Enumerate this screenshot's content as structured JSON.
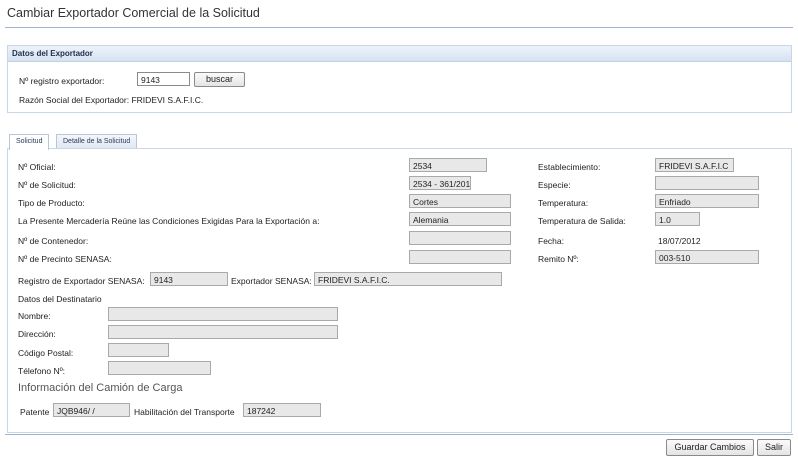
{
  "page": {
    "title": "Cambiar Exportador Comercial de la Solicitud"
  },
  "exporter_panel": {
    "header": "Datos del Exportador",
    "registro_label": "Nº registro exportador:",
    "registro_value": "9143",
    "search_button": "buscar",
    "razon_social": "Razón Social del Exportador: FRIDEVI S.A.F.I.C."
  },
  "tabs": [
    {
      "label": "Solicitud",
      "active": true
    },
    {
      "label": "Detalle de la Solicitud",
      "active": false
    }
  ],
  "solicitud": {
    "left": [
      {
        "label": "Nº Oficial:",
        "value": "2534"
      },
      {
        "label": "Nº de Solicitud:",
        "value": "2534 - 361/201"
      },
      {
        "label": "Tipo de Producto:",
        "value": "Cortes"
      },
      {
        "label": "La Presente Mercadería Reúne las Condiciones Exigidas Para la Exportación a:",
        "value": "Alemania"
      },
      {
        "label": "Nº de Contenedor:",
        "value": ""
      },
      {
        "label": "Nº de Precinto SENASA:",
        "value": ""
      }
    ],
    "right": [
      {
        "label": "Establecimiento:",
        "value": "FRIDEVI S.A.F.I.C"
      },
      {
        "label": "Especie:",
        "value": ""
      },
      {
        "label": "Temperatura:",
        "value": "Enfriado"
      },
      {
        "label": "Temperatura de Salida:",
        "value": "1.0"
      },
      {
        "label": "Fecha:",
        "value": "18/07/2012"
      },
      {
        "label": "Remito Nº:",
        "value": "003-510"
      }
    ],
    "registro_senasa_label": "Registro de Exportador SENASA:",
    "registro_senasa_value": "9143",
    "exportador_senasa_label": "Exportador SENASA:",
    "exportador_senasa_value": "FRIDEVI S.A.F.I.C.",
    "destinatario": {
      "heading": "Datos del Destinatario",
      "nombre_label": "Nombre:",
      "nombre_value": "",
      "direccion_label": "Dirección:",
      "direccion_value": "",
      "cp_label": "Código Postal:",
      "cp_value": "",
      "telefono_label": "Télefono Nº:",
      "telefono_value": ""
    },
    "camion": {
      "heading": "Información del Camión de Carga",
      "patente_label": "Patente",
      "patente_value": "JQB946/    /",
      "habilitacion_label": "Habilitación del Transporte",
      "habilitacion_value": "187242"
    }
  },
  "footer": {
    "save_button": "Guardar Cambios",
    "exit_button": "Salir"
  }
}
